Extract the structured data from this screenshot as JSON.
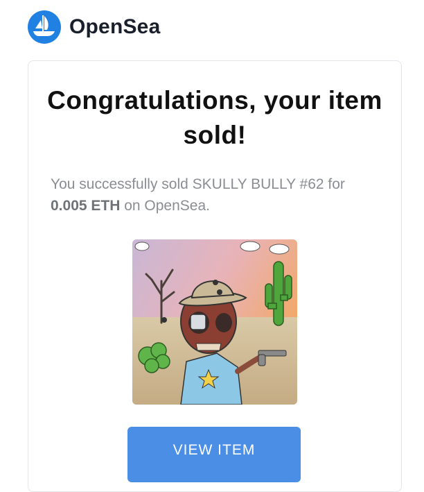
{
  "header": {
    "brand": "OpenSea",
    "logo_icon": "opensea-sailboat-icon",
    "logo_color": "#2081E2"
  },
  "email": {
    "title": "Congratulations, your item sold!",
    "message_prefix": "You successfully sold SKULLY BULLY #62 for ",
    "price": "0.005 ETH",
    "message_suffix": " on OpenSea.",
    "image_alt": "SKULLY BULLY #62",
    "button_label": "VIEW ITEM",
    "button_color": "#4b8ee6"
  }
}
